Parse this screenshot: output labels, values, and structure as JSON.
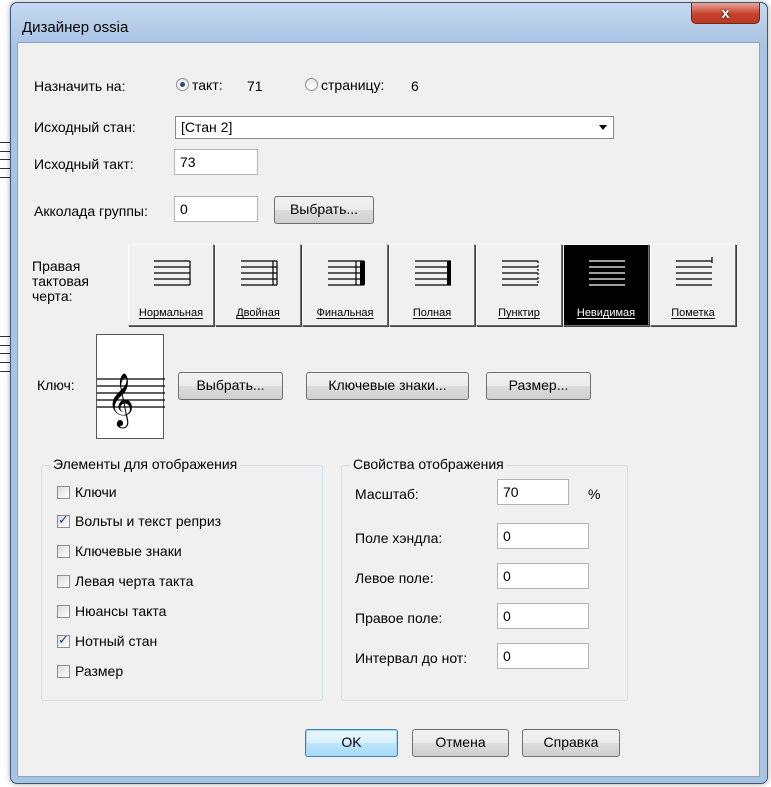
{
  "window": {
    "title": "Дизайнер ossia",
    "close_label": "x"
  },
  "assign": {
    "label": "Назначить на:",
    "bar_radio": "такт:",
    "bar_value": "71",
    "page_radio": "страницу:",
    "page_value": "6",
    "selected": "bar"
  },
  "source_staff": {
    "label": "Исходный стан:",
    "value": "[Стан 2]"
  },
  "source_bar": {
    "label": "Исходный такт:",
    "value": "73"
  },
  "group_brace": {
    "label": "Акколада группы:",
    "value": "0",
    "button": "Выбрать..."
  },
  "right_barline": {
    "label": "Правая тактовая черта:",
    "options": [
      {
        "label": "Нормальная",
        "selected": false
      },
      {
        "label": "Двойная",
        "selected": false
      },
      {
        "label": "Финальная",
        "selected": false
      },
      {
        "label": "Полная",
        "selected": false
      },
      {
        "label": "Пунктир",
        "selected": false
      },
      {
        "label": "Невидимая",
        "selected": true
      },
      {
        "label": "Пометка",
        "selected": false
      }
    ]
  },
  "clef": {
    "label": "Ключ:",
    "preview_icon": "treble-clef-icon",
    "select_button": "Выбрать...",
    "key_sig_button": "Ключевые знаки...",
    "time_sig_button": "Размер..."
  },
  "display_elements": {
    "title": "Элементы для отображения",
    "items": [
      {
        "label": "Ключи",
        "checked": false
      },
      {
        "label": "Вольты и текст реприз",
        "checked": true
      },
      {
        "label": "Ключевые знаки",
        "checked": false
      },
      {
        "label": "Левая черта такта",
        "checked": false
      },
      {
        "label": "Нюансы такта",
        "checked": false
      },
      {
        "label": "Нотный стан",
        "checked": true
      },
      {
        "label": "Размер",
        "checked": false
      }
    ]
  },
  "display_props": {
    "title": "Свойства отображения",
    "scale_label": "Масштаб:",
    "scale_value": "70",
    "scale_unit": "%",
    "handle_label": "Поле хэндла:",
    "handle_value": "0",
    "left_label": "Левое поле:",
    "left_value": "0",
    "right_label": "Правое поле:",
    "right_value": "0",
    "spacing_label": "Интервал до нот:",
    "spacing_value": "0"
  },
  "footer": {
    "ok": "OK",
    "cancel": "Отмена",
    "help": "Справка"
  }
}
